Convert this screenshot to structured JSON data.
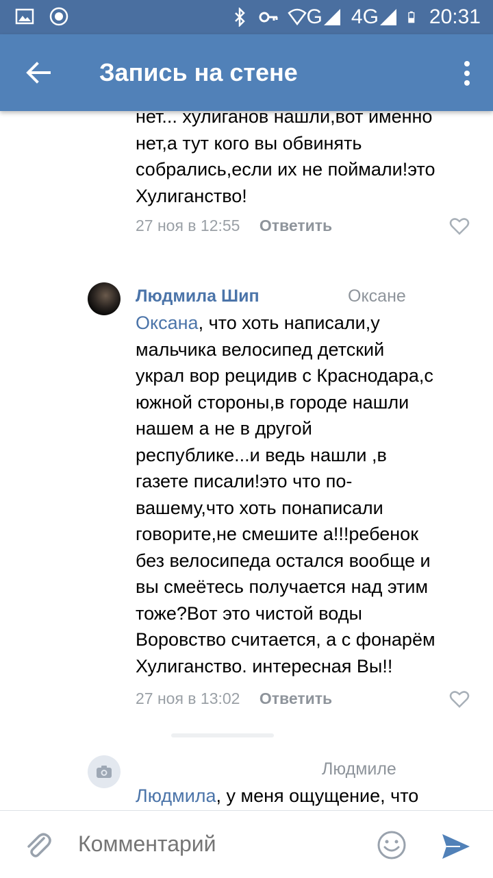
{
  "status_bar": {
    "network_label": "G",
    "network_4g": "4G",
    "time": "20:31"
  },
  "toolbar": {
    "title": "Запись на стене",
    "back_icon": "arrow-left-icon",
    "more_icon": "more-vertical-icon"
  },
  "comments": [
    {
      "text_lines": [
        "нет... хулиганов нашли,вот именно",
        "нет,а тут кого вы обвинять",
        "собрались,если их не поймали!это",
        "Хулиганство!"
      ],
      "date": "27 ноя в 12:55",
      "reply_label": "Ответить"
    },
    {
      "author": "Людмила Шип",
      "reply_to": "Оксане",
      "mention": "Оксана",
      "first_line_rest": ", что хоть написали,у",
      "text_lines": [
        "мальчика велосипед детский",
        "украл вор рецидив с Краснодара,с",
        "южной стороны,в городе нашли",
        "нашем а не в другой",
        "республике...и ведь нашли ,в",
        "газете писали!это что по-",
        "вашему,что хоть понаписали",
        "говорите,не смешите а!!!ребенок",
        "без велосипеда остался вообще и",
        "вы смеётесь получается над этим",
        "тоже?Вот это чистой воды",
        "Воровство считается, а с фонарём",
        "Хулиганство. интересная Вы!!"
      ],
      "date": "27 ноя в 13:02",
      "reply_label": "Ответить"
    },
    {
      "reply_to": "Людмиле",
      "mention": "Людмила",
      "first_line_rest": ", у меня ощущение, что"
    }
  ],
  "composer": {
    "placeholder": "Комментарий",
    "attach_icon": "paperclip-icon",
    "emoji_icon": "smile-icon",
    "send_icon": "send-icon"
  },
  "colors": {
    "toolbar": "#5181b8",
    "status_bar": "#4a6fa0",
    "link": "#4b74a9",
    "muted": "#8e949b"
  }
}
